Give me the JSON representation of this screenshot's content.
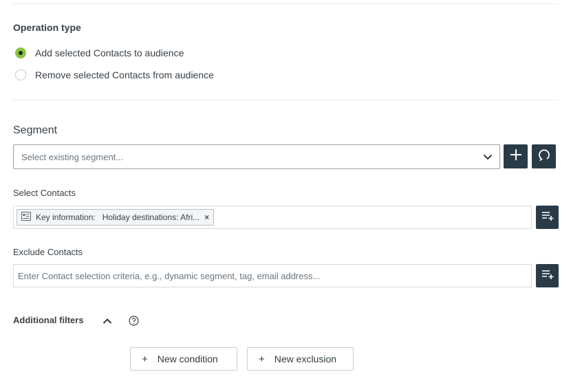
{
  "operation_type": {
    "title": "Operation type",
    "options": [
      {
        "label": "Add selected Contacts to audience",
        "selected": true
      },
      {
        "label": "Remove selected Contacts from audience",
        "selected": false
      }
    ]
  },
  "segment": {
    "title": "Segment",
    "placeholder": "Select existing segment...",
    "add_icon": "plus-icon",
    "refresh_icon": "refresh-icon"
  },
  "select_contacts": {
    "label": "Select Contacts",
    "chip_text": "Key information:   Holiday destinations: Afri...",
    "chip_remove": "×",
    "action_icon": "list-add-icon"
  },
  "exclude_contacts": {
    "label": "Exclude Contacts",
    "placeholder": "Enter Contact selection criteria, e.g., dynamic segment, tag, email address...",
    "action_icon": "list-add-icon"
  },
  "additional_filters": {
    "label": "Additional filters",
    "expanded": true,
    "help_icon": "question-circle-icon"
  },
  "buttons": {
    "plus_glyph": "+",
    "new_condition": "New condition",
    "new_exclusion": "New exclusion"
  },
  "colors": {
    "accent_green": "#8ac543",
    "dark_button": "#2a3b48",
    "border": "#d5dadd"
  }
}
